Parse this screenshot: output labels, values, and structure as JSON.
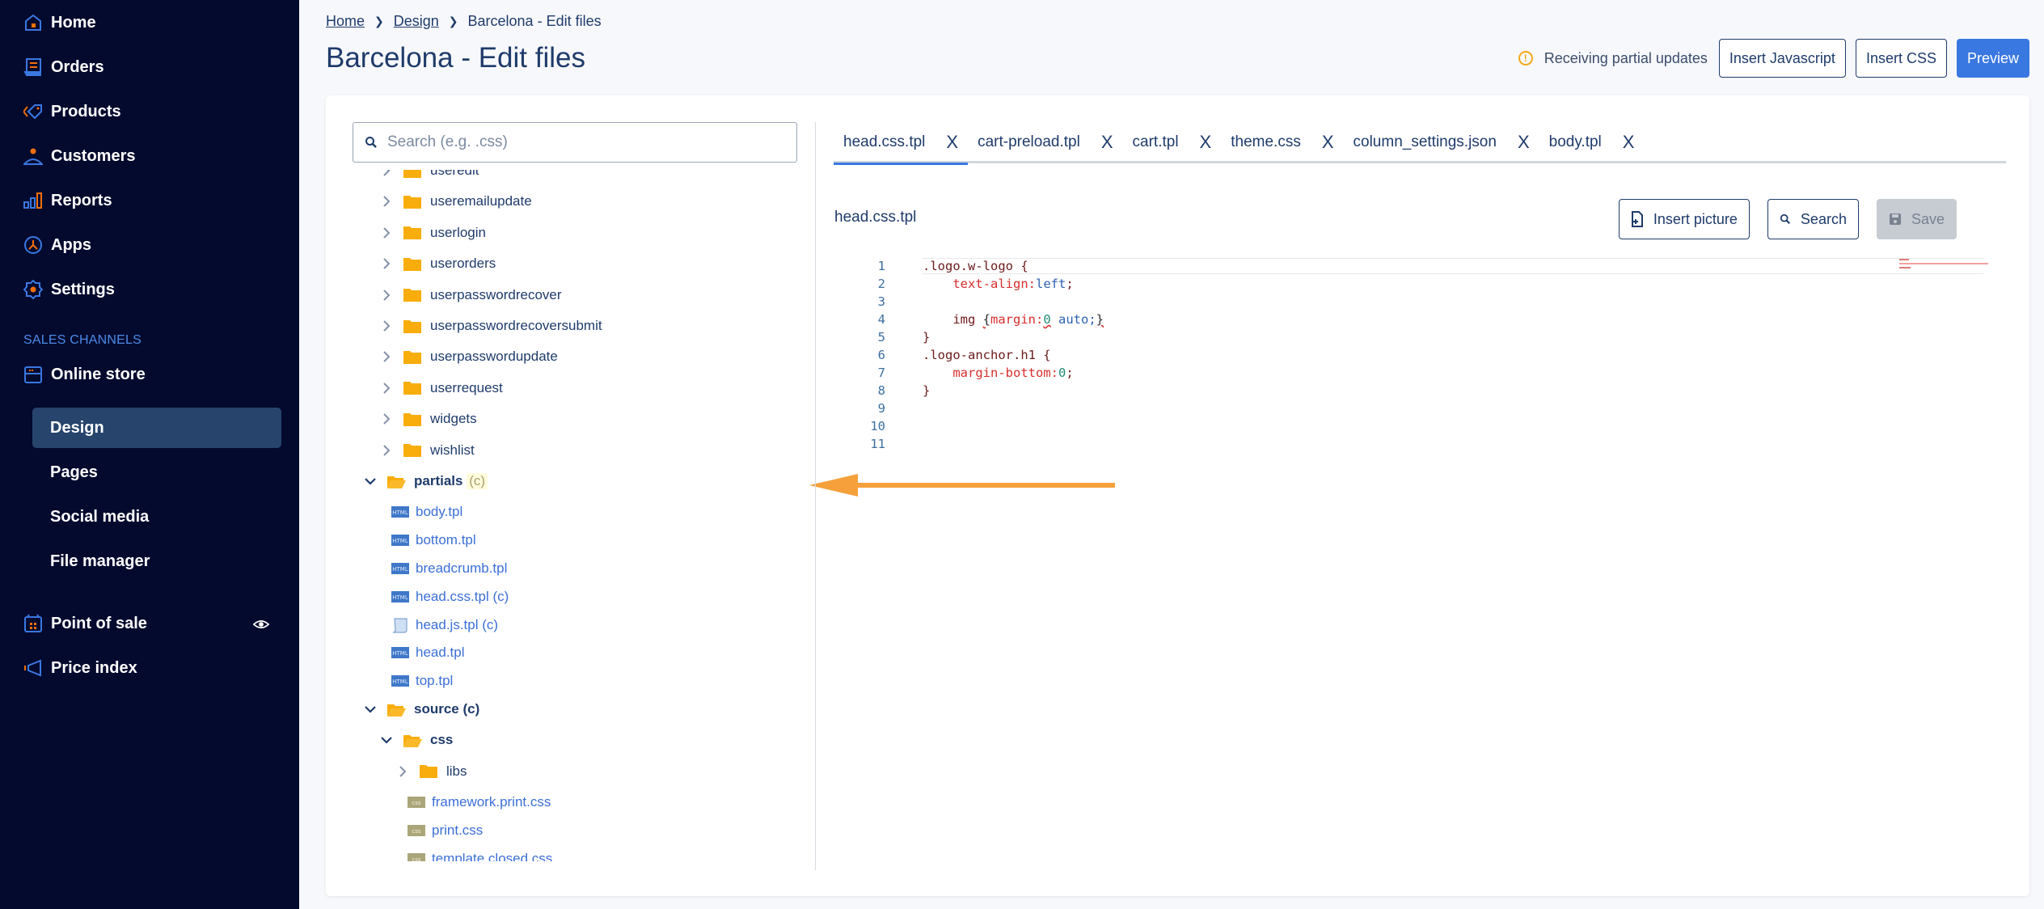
{
  "sidebar": {
    "main": [
      {
        "label": "Home",
        "icon": "home-icon"
      },
      {
        "label": "Orders",
        "icon": "orders-icon"
      },
      {
        "label": "Products",
        "icon": "tag-icon"
      },
      {
        "label": "Customers",
        "icon": "person-icon"
      },
      {
        "label": "Reports",
        "icon": "bar-chart-icon"
      },
      {
        "label": "Apps",
        "icon": "apps-icon"
      },
      {
        "label": "Settings",
        "icon": "gear-icon"
      }
    ],
    "section_label": "SALES CHANNELS",
    "online_store": {
      "label": "Online store",
      "icon": "store-icon"
    },
    "online_store_sub": [
      {
        "label": "Design",
        "active": true
      },
      {
        "label": "Pages"
      },
      {
        "label": "Social media"
      },
      {
        "label": "File manager"
      }
    ],
    "point_of_sale": {
      "label": "Point of sale",
      "icon": "pos-icon",
      "trailing_icon": "eye-icon"
    },
    "price_index": {
      "label": "Price index",
      "icon": "megaphone-icon"
    }
  },
  "breadcrumb": {
    "items": [
      "Home",
      "Design"
    ],
    "current": "Barcelona - Edit files"
  },
  "page": {
    "title": "Barcelona - Edit files",
    "status_text": "Receiving partial updates",
    "buttons": {
      "insert_js": "Insert Javascript",
      "insert_css": "Insert CSS",
      "preview": "Preview"
    }
  },
  "tree": {
    "search_placeholder": "Search (e.g. .css)",
    "rows": [
      {
        "type": "folder",
        "label": "useredit",
        "expanded": false,
        "depth": 1
      },
      {
        "type": "folder",
        "label": "useremailupdate",
        "expanded": false,
        "depth": 1
      },
      {
        "type": "folder",
        "label": "userlogin",
        "expanded": false,
        "depth": 1
      },
      {
        "type": "folder",
        "label": "userorders",
        "expanded": false,
        "depth": 1
      },
      {
        "type": "folder",
        "label": "userpasswordrecover",
        "expanded": false,
        "depth": 1
      },
      {
        "type": "folder",
        "label": "userpasswordrecoversubmit",
        "expanded": false,
        "depth": 1
      },
      {
        "type": "folder",
        "label": "userpasswordupdate",
        "expanded": false,
        "depth": 1
      },
      {
        "type": "folder",
        "label": "userrequest",
        "expanded": false,
        "depth": 1
      },
      {
        "type": "folder",
        "label": "widgets",
        "expanded": false,
        "depth": 1
      },
      {
        "type": "folder",
        "label": "wishlist",
        "expanded": false,
        "depth": 1
      },
      {
        "type": "folder",
        "label": "partials",
        "mark": "(c)",
        "expanded": true,
        "depth": 0
      },
      {
        "type": "file",
        "label": "body.tpl",
        "filetype": "html",
        "depth": 0
      },
      {
        "type": "file",
        "label": "bottom.tpl",
        "filetype": "html",
        "depth": 0
      },
      {
        "type": "file",
        "label": "breadcrumb.tpl",
        "filetype": "html",
        "depth": 0
      },
      {
        "type": "file",
        "label": "head.css.tpl (c)",
        "filetype": "html",
        "depth": 0
      },
      {
        "type": "file",
        "label": "head.js.tpl (c)",
        "filetype": "script",
        "depth": 0
      },
      {
        "type": "file",
        "label": "head.tpl",
        "filetype": "html",
        "depth": 0
      },
      {
        "type": "file",
        "label": "top.tpl",
        "filetype": "html",
        "depth": 0
      },
      {
        "type": "folder",
        "label": "source (c)",
        "expanded": true,
        "depth": 0
      },
      {
        "type": "folder",
        "label": "css",
        "expanded": true,
        "depth": 1
      },
      {
        "type": "folder",
        "label": "libs",
        "expanded": false,
        "depth": 2
      },
      {
        "type": "file",
        "label": "framework.print.css",
        "filetype": "css",
        "depth": 1
      },
      {
        "type": "file",
        "label": "print.css",
        "filetype": "css",
        "depth": 1
      },
      {
        "type": "file",
        "label": "template.closed.css",
        "filetype": "css",
        "depth": 1
      }
    ]
  },
  "tabs": [
    {
      "label": "head.css.tpl",
      "active": true
    },
    {
      "label": "cart-preload.tpl"
    },
    {
      "label": "cart.tpl"
    },
    {
      "label": "theme.css"
    },
    {
      "label": "column_settings.json"
    },
    {
      "label": "body.tpl"
    }
  ],
  "tab_close_glyph": "X",
  "editor": {
    "file_name": "head.css.tpl",
    "buttons": {
      "insert_picture": "Insert picture",
      "search": "Search",
      "save": "Save"
    },
    "lines": [
      ".logo.w-logo {",
      "    text-align:left;",
      "",
      "    img {margin:0 auto;}",
      "}",
      ".logo-anchor.h1 {",
      "    margin-bottom:0;",
      "}",
      "",
      "",
      ""
    ]
  },
  "colors": {
    "sidebar_bg": "#030a2e",
    "accent": "#3a78e1",
    "folder": "#f9ad0c",
    "annotation_arrow": "#f5a03a",
    "warning": "#f3a71b"
  }
}
